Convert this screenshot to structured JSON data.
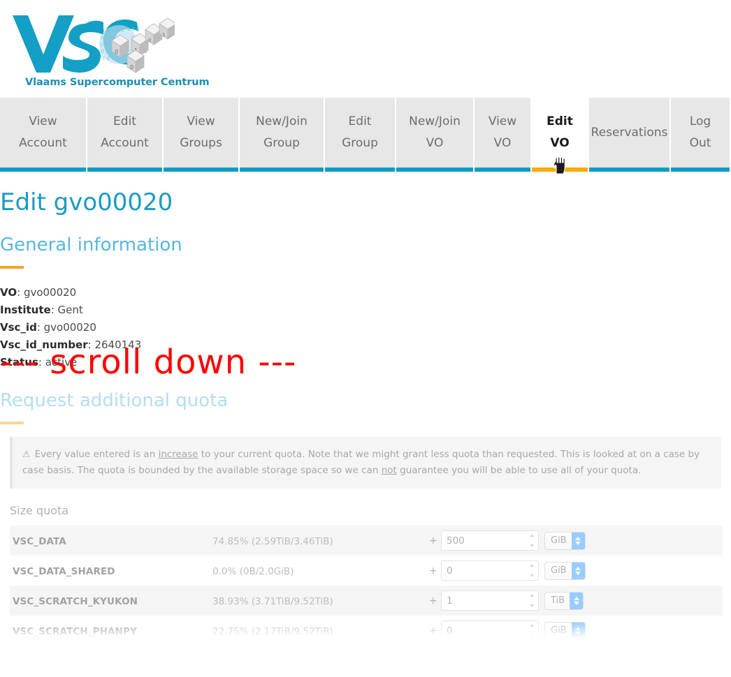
{
  "brand": {
    "acronym": "VSC",
    "tagline": "Vlaams Supercomputer Centrum",
    "logo_color": "#149fc4",
    "accent_color": "#f5a623",
    "teal_color": "#0e9bc4"
  },
  "nav": {
    "tabs": [
      {
        "line1": "View",
        "line2": "Account",
        "active": false
      },
      {
        "line1": "Edit",
        "line2": "Account",
        "active": false
      },
      {
        "line1": "View",
        "line2": "Groups",
        "active": false
      },
      {
        "line1": "New/Join",
        "line2": "Group",
        "active": false
      },
      {
        "line1": "Edit",
        "line2": "Group",
        "active": false
      },
      {
        "line1": "New/Join",
        "line2": "VO",
        "active": false
      },
      {
        "line1": "View",
        "line2": "VO",
        "active": false
      },
      {
        "line1": "Edit",
        "line2": "VO",
        "active": true
      },
      {
        "line1": "Reservations",
        "line2": "",
        "active": false
      },
      {
        "line1": "Log",
        "line2": "Out",
        "active": false
      }
    ]
  },
  "page": {
    "title": "Edit gvo00020",
    "section_general": "General information",
    "scroll_banner": "--- scroll down ---",
    "section_quota": "Request additional quota",
    "size_quota_label": "Size quota"
  },
  "general_info": [
    {
      "key": "VO",
      "sep": ": ",
      "value": "gvo00020"
    },
    {
      "key": "Institute",
      "sep": ": ",
      "value": "Gent"
    },
    {
      "key": "Vsc_id",
      "sep": ": ",
      "value": "gvo00020"
    },
    {
      "key": "Vsc_id_number",
      "sep": ": ",
      "value": "2640143"
    },
    {
      "key": "Status",
      "sep": ": ",
      "value": "active"
    }
  ],
  "warning": {
    "icon": "warning-triangle-icon",
    "part1": "Every value entered is an ",
    "emph1": "increase",
    "part2": " to your current quota. Note that we might grant less quota than requested. This is looked at on a case by case basis. The quota is bounded by the available storage space so we can ",
    "emph2": "not",
    "part3": " guarantee you will be able to use all of your quota."
  },
  "quota_rows": [
    {
      "name": "VSC_DATA",
      "usage": "74.85% (2.59TiB/3.46TiB)",
      "plus": "+",
      "input_value": "500",
      "unit": "GiB"
    },
    {
      "name": "VSC_DATA_SHARED",
      "usage": "0.0% (0B/2.0GiB)",
      "plus": "+",
      "input_value": "0",
      "unit": "GiB"
    },
    {
      "name": "VSC_SCRATCH_KYUKON",
      "usage": "38.93% (3.71TiB/9.52TiB)",
      "plus": "+",
      "input_value": "1",
      "unit": "TiB"
    },
    {
      "name": "VSC_SCRATCH_PHANPY",
      "usage": "22.75% (2.17TiB/9.52TiB)",
      "plus": "+",
      "input_value": "0",
      "unit": "GiB"
    }
  ]
}
